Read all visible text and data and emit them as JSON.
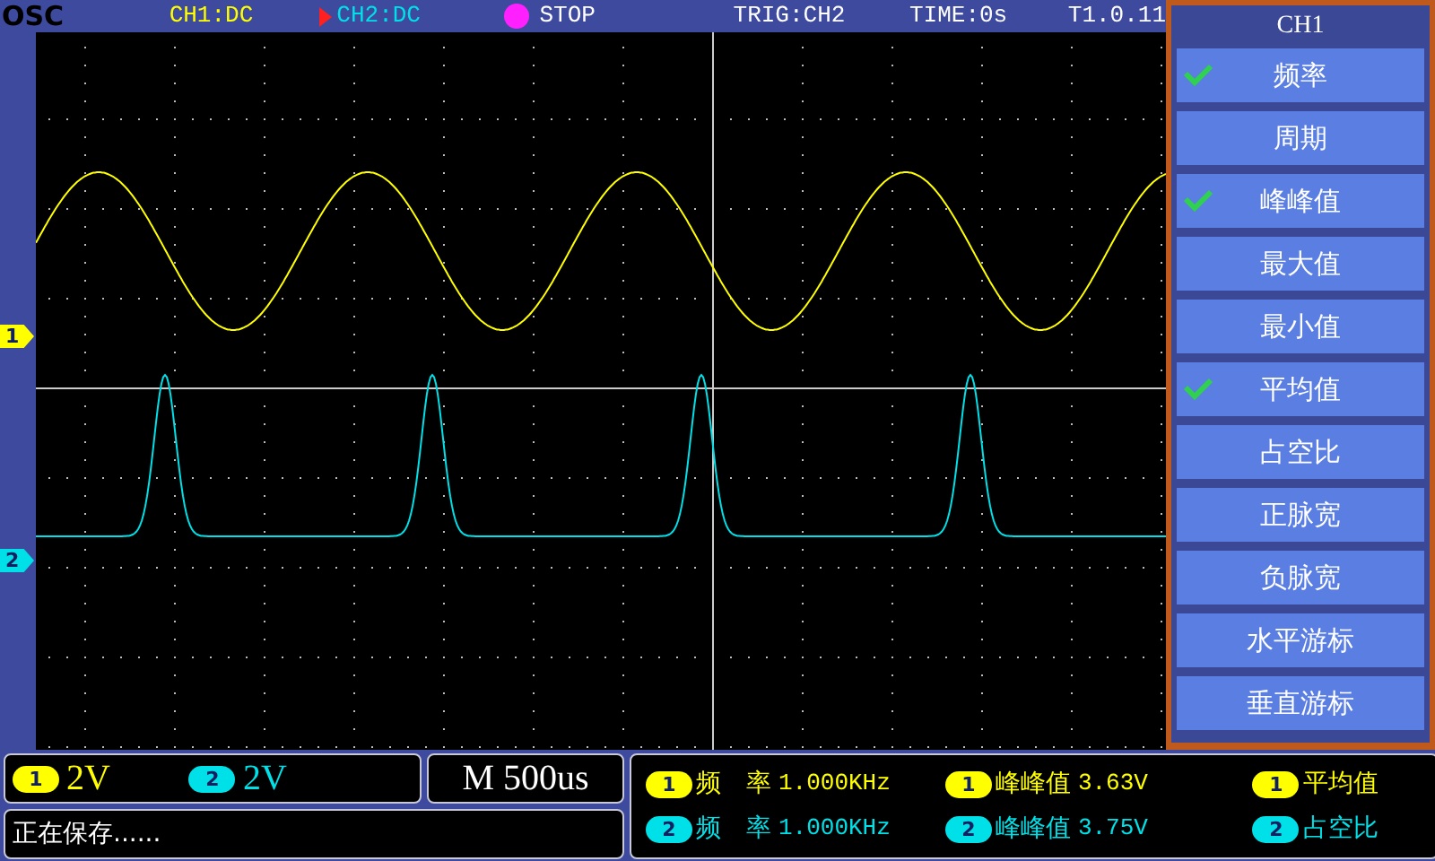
{
  "status_bar": {
    "logo": "OSC",
    "ch1_coupling": "CH1:DC",
    "ch2_coupling": "CH2:DC",
    "run_state": "STOP",
    "trigger": "TRIG:CH2",
    "time": "TIME:0s",
    "version": "T1.0.11"
  },
  "channels": [
    {
      "number": "1",
      "color": "#ffff00"
    },
    {
      "number": "2",
      "color": "#00e0e8"
    }
  ],
  "menu": {
    "title": "CH1",
    "items": [
      {
        "label": "频率",
        "checked": true
      },
      {
        "label": "周期",
        "checked": false
      },
      {
        "label": "峰峰值",
        "checked": true
      },
      {
        "label": "最大值",
        "checked": false
      },
      {
        "label": "最小值",
        "checked": false
      },
      {
        "label": "平均值",
        "checked": true
      },
      {
        "label": "占空比",
        "checked": false
      },
      {
        "label": "正脉宽",
        "checked": false
      },
      {
        "label": "负脉宽",
        "checked": false
      },
      {
        "label": "水平游标",
        "checked": false
      },
      {
        "label": "垂直游标",
        "checked": false
      }
    ]
  },
  "scale": {
    "volts": [
      {
        "channel": "1",
        "value": "2V"
      },
      {
        "channel": "2",
        "value": "2V"
      }
    ],
    "timebase": "M 500us"
  },
  "message": "正在保存......",
  "measurements": [
    [
      {
        "channel": "1",
        "label": "频　率",
        "value": "1.000KHz"
      },
      {
        "channel": "1",
        "label": "峰峰值",
        "value": "3.63V"
      },
      {
        "channel": "1",
        "label": "平均值"
      }
    ],
    [
      {
        "channel": "2",
        "label": "频　率",
        "value": "1.000KHz"
      },
      {
        "channel": "2",
        "label": "峰峰值",
        "value": "3.75V"
      },
      {
        "channel": "2",
        "label": "占空比"
      }
    ]
  ]
}
